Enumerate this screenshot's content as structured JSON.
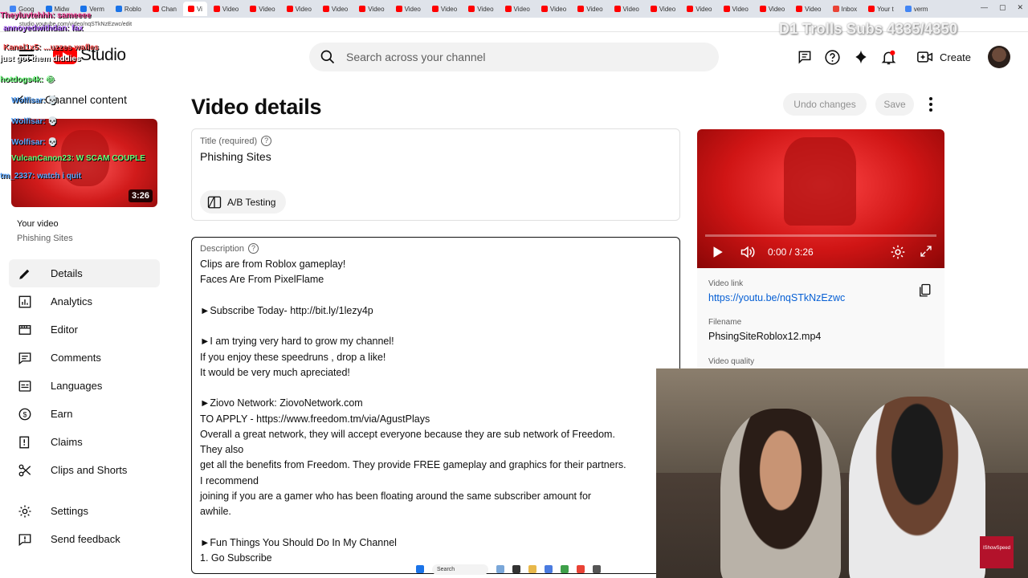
{
  "browser": {
    "tabs": [
      {
        "label": "Goog",
        "color": "#4285f4"
      },
      {
        "label": "Midw",
        "color": "#1a73e8"
      },
      {
        "label": "Verm",
        "color": "#1a73e8"
      },
      {
        "label": "Roblo",
        "color": "#1a73e8"
      },
      {
        "label": "Chan",
        "color": "#ff0000"
      },
      {
        "label": "Vi",
        "color": "#ff0000",
        "active": true
      },
      {
        "label": "Video",
        "color": "#ff0000"
      },
      {
        "label": "Video",
        "color": "#ff0000"
      },
      {
        "label": "Video",
        "color": "#ff0000"
      },
      {
        "label": "Video",
        "color": "#ff0000"
      },
      {
        "label": "Video",
        "color": "#ff0000"
      },
      {
        "label": "Video",
        "color": "#ff0000"
      },
      {
        "label": "Video",
        "color": "#ff0000"
      },
      {
        "label": "Video",
        "color": "#ff0000"
      },
      {
        "label": "Video",
        "color": "#ff0000"
      },
      {
        "label": "Video",
        "color": "#ff0000"
      },
      {
        "label": "Video",
        "color": "#ff0000"
      },
      {
        "label": "Video",
        "color": "#ff0000"
      },
      {
        "label": "Video",
        "color": "#ff0000"
      },
      {
        "label": "Video",
        "color": "#ff0000"
      },
      {
        "label": "Video",
        "color": "#ff0000"
      },
      {
        "label": "Video",
        "color": "#ff0000"
      },
      {
        "label": "Video",
        "color": "#ff0000"
      },
      {
        "label": "Inbox",
        "color": "#ea4335"
      },
      {
        "label": "Your t",
        "color": "#ff0000"
      },
      {
        "label": "verm",
        "color": "#4285f4"
      }
    ],
    "url": "studio.youtube.com/video/nqSTkNzEzwc/edit"
  },
  "header": {
    "logo_text": "Studio",
    "search_placeholder": "Search across your channel",
    "create_label": "Create"
  },
  "sidebar": {
    "back_label": "Channel content",
    "thumbnail_duration": "3:26",
    "your_video_label": "Your video",
    "video_title": "Phishing Sites",
    "items": [
      {
        "label": "Details",
        "icon": "pencil-icon",
        "active": true
      },
      {
        "label": "Analytics",
        "icon": "analytics-icon"
      },
      {
        "label": "Editor",
        "icon": "editor-icon"
      },
      {
        "label": "Comments",
        "icon": "comments-icon"
      },
      {
        "label": "Languages",
        "icon": "languages-icon"
      },
      {
        "label": "Earn",
        "icon": "earn-icon"
      },
      {
        "label": "Claims",
        "icon": "claims-icon"
      },
      {
        "label": "Clips and Shorts",
        "icon": "scissors-icon"
      }
    ],
    "footer_items": [
      {
        "label": "Settings",
        "icon": "gear-icon"
      },
      {
        "label": "Send feedback",
        "icon": "feedback-icon"
      }
    ]
  },
  "main": {
    "page_title": "Video details",
    "undo_label": "Undo changes",
    "save_label": "Save",
    "title_field": {
      "label": "Title (required)",
      "value": "Phishing Sites"
    },
    "ab_testing_label": "A/B Testing",
    "description": {
      "label": "Description",
      "lines": [
        "Clips are from Roblox gameplay!",
        "Faces Are From PixelFlame",
        "",
        "►Subscribe Today- http://bit.ly/1lezy4p",
        "",
        "►I am trying very hard to grow my channel!",
        "If you enjoy these speedruns , drop a like!",
        "It would be very much apreciated!",
        "",
        "►Ziovo Network: ZiovoNetwork.com",
        "TO APPLY - https://www.freedom.tm/via/AgustPlays",
        "Overall a great network, they will accept everyone because they are sub network of Freedom.",
        "They also",
        "get all the benefits from Freedom. They provide FREE gameplay and graphics for their partners.",
        "I recommend",
        "joining if you are a gamer who has been floating around the same subscriber amount for",
        "awhile.",
        "",
        "►Fun Things You Should Do In My Channel",
        "1. Go Subscribe"
      ]
    }
  },
  "player": {
    "time": "0:00 / 3:26",
    "progress": 0
  },
  "video_info": {
    "link_label": "Video link",
    "link": "https://youtu.be/nqSTkNzEzwc",
    "filename_label": "Filename",
    "filename": "PhsingSiteRoblox12.mp4",
    "quality_label": "Video quality"
  },
  "stream_overlay": {
    "sub_counter": "D1 Trolls Subs 4335/4350",
    "chat": [
      {
        "text": "Theyluvtehhh: sameeee",
        "color": "#ff4fa3"
      },
      {
        "text": "annoyedwithdan: fax",
        "color": "#b36bff"
      },
      {
        "text": "Kanel1x5: ...uzzes wafles",
        "color": "#ff5c5c"
      },
      {
        "text": "just got them diddies",
        "color": "#ffffff"
      },
      {
        "text": "hotdogs4k: 😂",
        "color": "#6bff7a"
      },
      {
        "text": "Wolfisar: 💀",
        "color": "#5fa8ff"
      },
      {
        "text": "Wolfisar: 💀",
        "color": "#5fa8ff"
      },
      {
        "text": "Wolfisar: 💀",
        "color": "#5fa8ff"
      },
      {
        "text": "VulcanCanon23: W SCAM COUPLE",
        "color": "#6bff7a"
      },
      {
        "text": "tm_2337: watch i quit",
        "color": "#5fa8ff"
      }
    ],
    "webcam_badge": "IShowSpeed"
  },
  "taskbar": {
    "search_label": "Search"
  },
  "colors": {
    "accent_red": "#ff0000",
    "link_blue": "#065fd4"
  }
}
